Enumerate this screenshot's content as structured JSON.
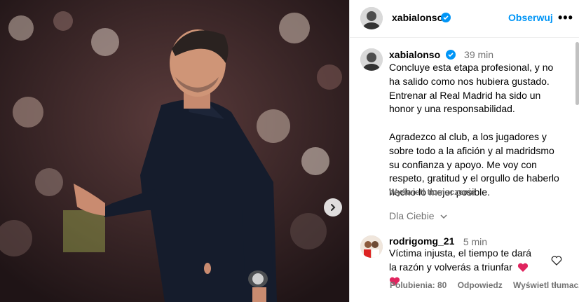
{
  "post": {
    "author": "xabialonso",
    "follow_label": "Obserwuj",
    "more_label": "•••",
    "media_alt": "Photo of a coach in a dark polo shirt gesturing on the sideline of a stadium",
    "carousel_next_icon": "chevron-right-icon"
  },
  "caption": {
    "author": "xabialonso",
    "time": "39 min",
    "text": "Concluye esta etapa profesional, y no ha salido como nos hubiera gustado. Entrenar al Real Madrid ha sido un honor y una responsabilidad.\n\nAgradezco al club, a los jugadores y sobre todo a la afición y al madridsmo su confianza y apoyo. Me voy con respeto, gratitud y el orgullo de haberlo hecho lo mejor posible.",
    "translate_label": "Wyświetl tłumaczenie"
  },
  "filter": {
    "label": "Dla Ciebie"
  },
  "comments": [
    {
      "author": "rodrigomg_21",
      "time": "5 min",
      "text": "Víctima injusta, el tiempo te dará la razón y volverás a triunfar",
      "likes_label": "Polubienia: 80",
      "reply_label": "Odpowiedz",
      "translate_label": "Wyświetl tłumaczenie"
    }
  ],
  "colors": {
    "accent": "#0095f6",
    "verified": "#0095f6",
    "secondary_text": "#737373",
    "heart_emoji": "#e0245e"
  }
}
